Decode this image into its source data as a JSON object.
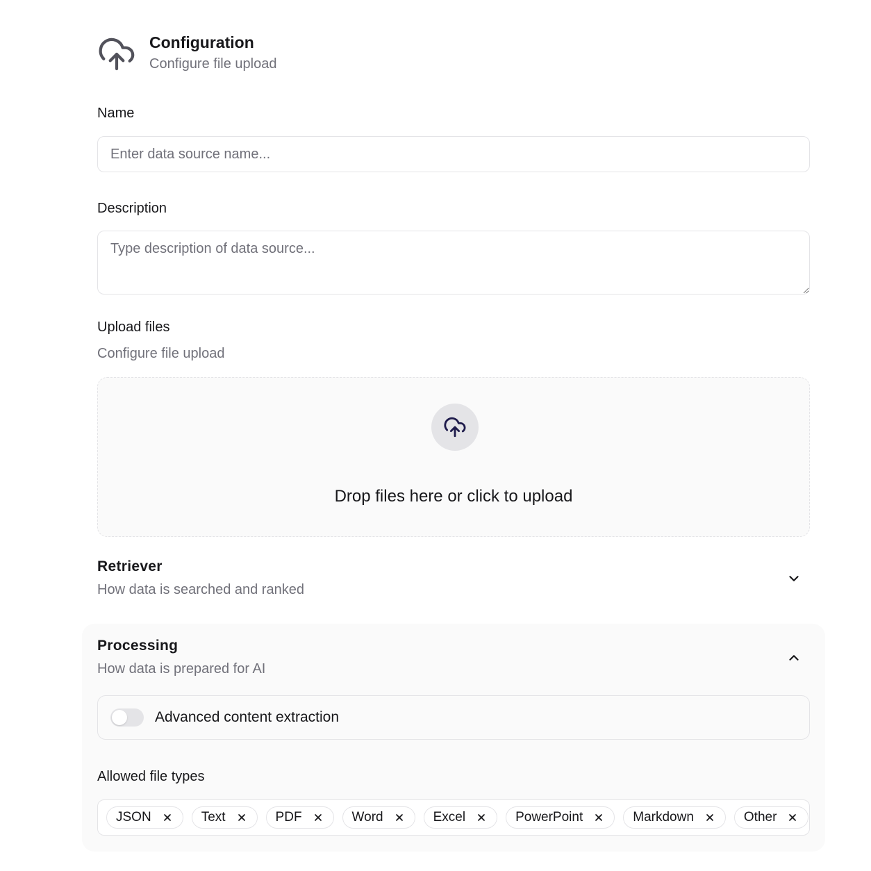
{
  "header": {
    "title": "Configuration",
    "subtitle": "Configure file upload",
    "icon": "cloud-upload-icon"
  },
  "name_field": {
    "label": "Name",
    "value": "",
    "placeholder": "Enter data source name..."
  },
  "description_field": {
    "label": "Description",
    "value": "",
    "placeholder": "Type description of data source..."
  },
  "upload": {
    "label": "Upload files",
    "sublabel": "Configure file upload",
    "dropzone_text": "Drop files here or click to upload",
    "icon": "cloud-upload-icon"
  },
  "retriever": {
    "title": "Retriever",
    "subtitle": "How data is searched and ranked",
    "expanded": false,
    "icon": "chevron-down-icon"
  },
  "processing": {
    "title": "Processing",
    "subtitle": "How data is prepared for AI",
    "expanded": true,
    "icon": "chevron-up-icon",
    "advanced_extraction": {
      "label": "Advanced content extraction",
      "enabled": false
    },
    "allowed_file_types": {
      "label": "Allowed file types",
      "tags": [
        "JSON",
        "Text",
        "PDF",
        "Word",
        "Excel",
        "PowerPoint",
        "Markdown",
        "Other"
      ]
    }
  },
  "colors": {
    "text_primary": "#18181b",
    "text_muted": "#71717a",
    "border": "#e4e4e7",
    "panel_bg": "#fafafa",
    "icon_dark": "#1e1b4b"
  }
}
